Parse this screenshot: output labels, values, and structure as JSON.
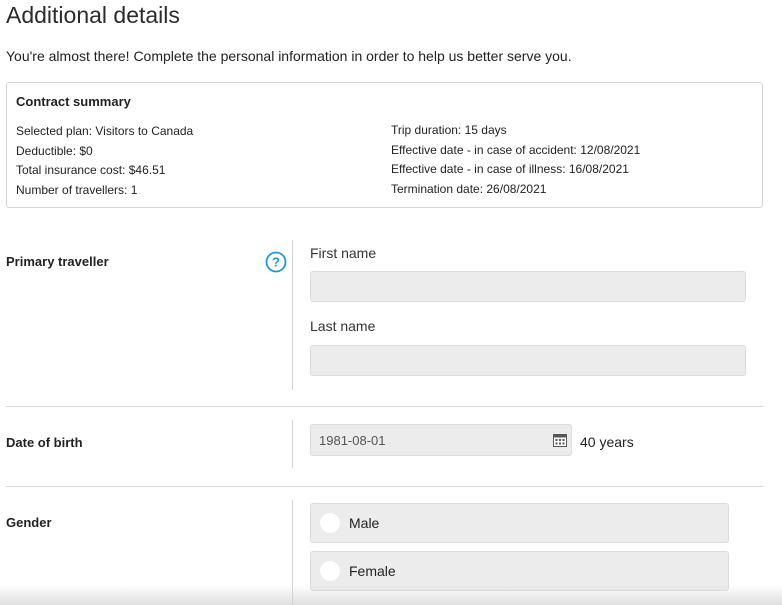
{
  "page": {
    "title": "Additional details",
    "intro": "You're almost there! Complete the personal information in order to help us better serve you."
  },
  "summary": {
    "title": "Contract summary",
    "left": [
      "Selected plan: Visitors to Canada",
      "Deductible:  $0",
      "Total insurance cost:  $46.51",
      "Number of travellers:  1"
    ],
    "right": [
      "Trip duration:  15 days",
      "Effective date - in case of accident:  12/08/2021",
      "Effective date - in case of illness:  16/08/2021",
      "Termination date:  26/08/2021"
    ]
  },
  "primary_traveller": {
    "label": "Primary traveller",
    "help_icon": "question-circle-icon",
    "first_name_label": "First name",
    "first_name_value": "",
    "last_name_label": "Last name",
    "last_name_value": ""
  },
  "date_of_birth": {
    "label": "Date of birth",
    "value": "1981-08-01",
    "icon": "calendar-icon",
    "age": "40 years"
  },
  "gender": {
    "label": "Gender",
    "options": [
      "Male",
      "Female"
    ]
  },
  "colors": {
    "accent": "#1a9bd7",
    "input_bg": "#ececed",
    "border": "#d4d4d4"
  }
}
